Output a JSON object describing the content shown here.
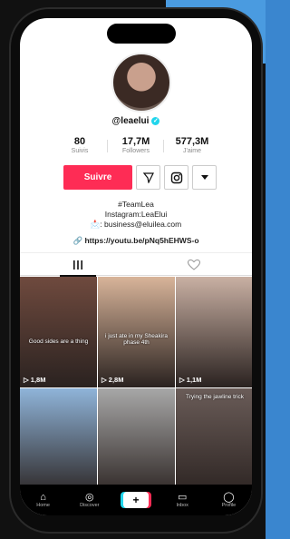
{
  "profile": {
    "handle": "@leaelui",
    "stats": [
      {
        "value": "80",
        "label": "Suivis"
      },
      {
        "value": "17,7M",
        "label": "Followers"
      },
      {
        "value": "577,3M",
        "label": "J'aime"
      }
    ],
    "follow_label": "Suivre",
    "bio_lines": [
      "#TeamLea",
      "Instagram:LeaElui",
      "📩: business@eluilea.com"
    ],
    "link": "https://youtu.be/pNq5hEHWS-o"
  },
  "videos": [
    {
      "views": "1,8M",
      "caption": "Good sides are a thing",
      "bg": "#6f4a3e"
    },
    {
      "views": "2,8M",
      "caption": "i just ate in my Sheakira phase 4th",
      "bg": "#d8b49a"
    },
    {
      "views": "1,1M",
      "caption": "",
      "bg": "#c9b0a3"
    },
    {
      "views": "",
      "caption": "",
      "bg": "#8fb4d9"
    },
    {
      "views": "",
      "caption": "",
      "bg": "#a7a7a7"
    },
    {
      "views": "",
      "caption": "Trying the jawline trick",
      "bg": "#6a5c58"
    }
  ],
  "nav": [
    {
      "label": "Home",
      "icon": "⌂",
      "icon_name": "home-icon"
    },
    {
      "label": "Discover",
      "icon": "◎",
      "icon_name": "discover-icon"
    },
    {
      "label": "",
      "icon": "+",
      "icon_name": "create-icon"
    },
    {
      "label": "Inbox",
      "icon": "▭",
      "icon_name": "inbox-icon"
    },
    {
      "label": "Profile",
      "icon": "◯",
      "icon_name": "profile-icon"
    }
  ]
}
